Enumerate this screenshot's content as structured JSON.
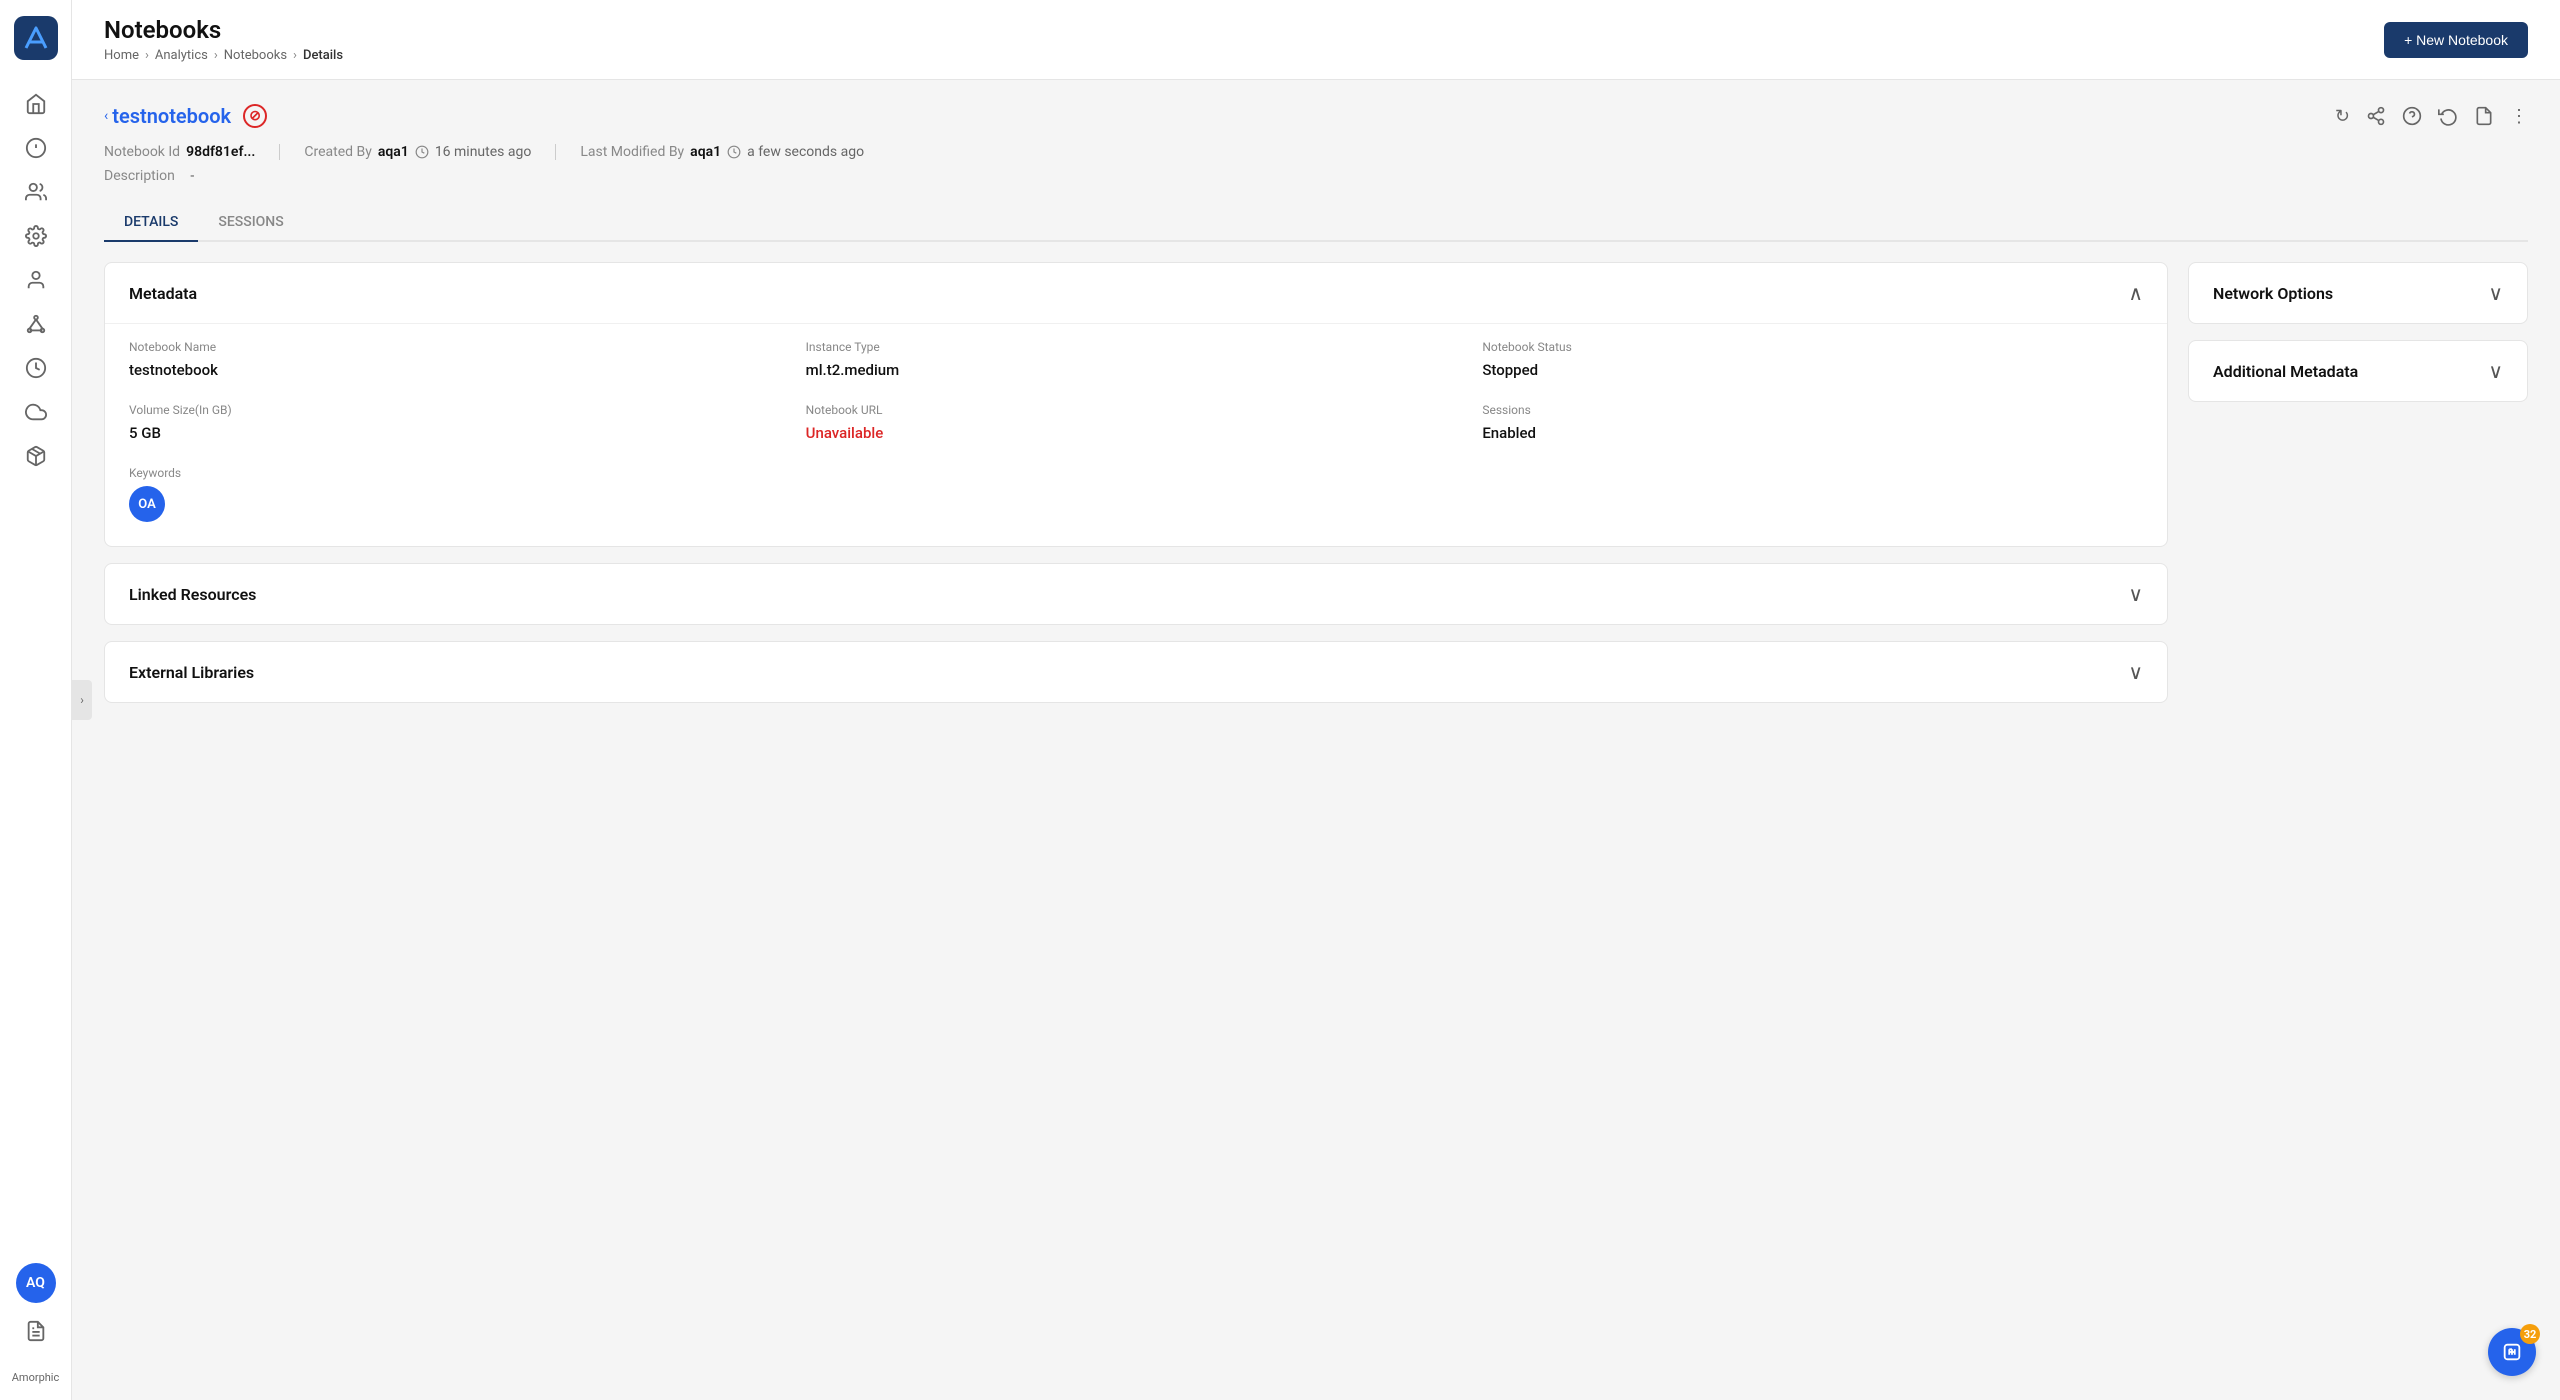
{
  "app": {
    "name": "Amorphic",
    "logo_initials": "A"
  },
  "header": {
    "title": "Notebooks",
    "new_button_label": "+ New Notebook",
    "breadcrumb": [
      "Home",
      "Analytics",
      "Notebooks",
      "Details"
    ]
  },
  "page": {
    "back_label": "< testnotebook",
    "notebook_title": "testnotebook",
    "notebook_id_label": "Notebook Id",
    "notebook_id_value": "98df81ef...",
    "created_by_label": "Created By",
    "created_by_user": "aqa1",
    "created_time": "16 minutes ago",
    "modified_by_label": "Last Modified By",
    "modified_by_user": "aqa1",
    "modified_time": "a few seconds ago",
    "description_label": "Description",
    "description_value": "-"
  },
  "tabs": [
    {
      "label": "DETAILS",
      "active": true
    },
    {
      "label": "SESSIONS",
      "active": false
    }
  ],
  "metadata_card": {
    "title": "Metadata",
    "fields": [
      {
        "label": "Notebook Name",
        "value": "testnotebook",
        "type": "text"
      },
      {
        "label": "Instance Type",
        "value": "ml.t2.medium",
        "type": "text"
      },
      {
        "label": "Notebook Status",
        "value": "Stopped",
        "type": "text"
      },
      {
        "label": "Volume Size(In GB)",
        "value": "5 GB",
        "type": "text"
      },
      {
        "label": "Notebook URL",
        "value": "Unavailable",
        "type": "link"
      },
      {
        "label": "Sessions",
        "value": "Enabled",
        "type": "text"
      }
    ],
    "keywords_label": "Keywords",
    "keywords": [
      {
        "display": "OA"
      }
    ]
  },
  "linked_resources_card": {
    "title": "Linked Resources"
  },
  "external_libraries_card": {
    "title": "External Libraries"
  },
  "network_options_card": {
    "title": "Network Options"
  },
  "additional_metadata_card": {
    "title": "Additional Metadata"
  },
  "notification": {
    "count": "32"
  },
  "sidebar": {
    "avatar": "AQ",
    "doc_icon": "📄",
    "brand": "Amorphic"
  }
}
